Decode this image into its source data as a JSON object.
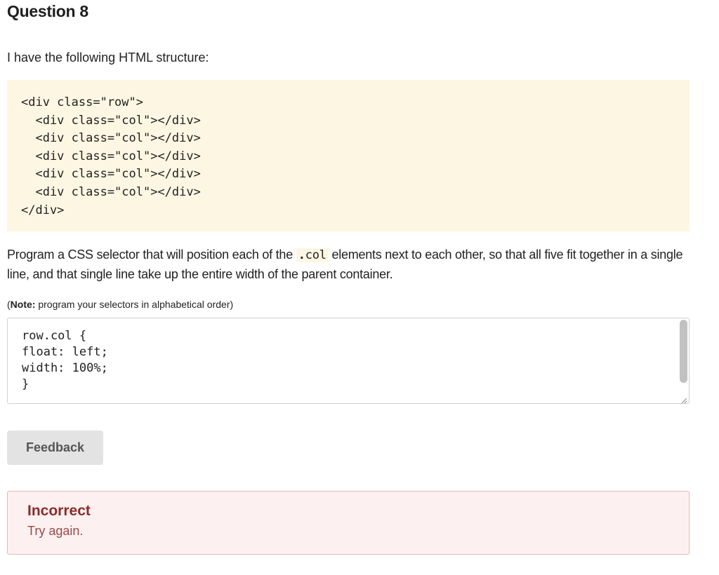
{
  "question": {
    "title": "Question 8",
    "intro": "I have the following HTML structure:"
  },
  "html_code": {
    "lines": [
      "<div class=\"row\">",
      "  <div class=\"col\"></div>",
      "  <div class=\"col\"></div>",
      "  <div class=\"col\"></div>",
      "  <div class=\"col\"></div>",
      "  <div class=\"col\"></div>",
      "</div>"
    ]
  },
  "prompt": {
    "before": "Program a CSS selector that will position each of the ",
    "code_dot": ".",
    "code_word": "col",
    "after": " elements next to each other, so that all five fit together in a single line, and that single line take up the entire width of the parent container."
  },
  "note": {
    "label": "Note:",
    "text": " program your selectors in alphabetical order)",
    "open_paren": "("
  },
  "answer": {
    "value": "row.col {\nfloat: left;\nwidth: 100%;\n}"
  },
  "feedback_button": {
    "label": "Feedback"
  },
  "result": {
    "status": "Incorrect",
    "message": "Try again.",
    "colors": {
      "background": "#fdf0f0",
      "border": "#e9b8b8",
      "title": "#8b2b2b",
      "message": "#9a4a4a"
    }
  },
  "code_background_color": "#fdf6e3"
}
